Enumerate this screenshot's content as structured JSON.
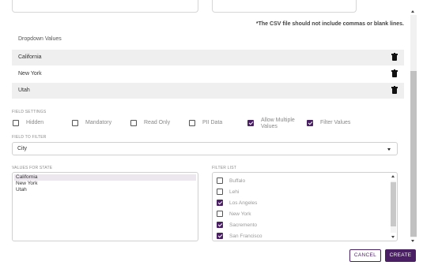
{
  "top_inputs": {
    "left_placeholder": "",
    "right_placeholder": ""
  },
  "csv_note": "*The CSV file should not include commas or blank lines.",
  "dropdown_values": {
    "label": "Dropdown Values",
    "items": [
      "California",
      "New York",
      "Utah"
    ]
  },
  "field_settings": {
    "label": "FIELD SETTINGS",
    "options": [
      {
        "label": "Hidden",
        "checked": false
      },
      {
        "label": "Mandatory",
        "checked": false
      },
      {
        "label": "Read Only",
        "checked": false
      },
      {
        "label": "PII Data",
        "checked": false
      },
      {
        "label": "Allow Multiple Values",
        "line1": "Allow Multiple",
        "line2": "Values",
        "checked": true
      },
      {
        "label": "Filter Values",
        "checked": true
      }
    ]
  },
  "field_to_filter": {
    "label": "FIELD TO FILTER",
    "value": "City"
  },
  "values_for_state": {
    "label": "VALUES FOR STATE",
    "options": [
      "California",
      "New York",
      "Utah"
    ],
    "selected": "California"
  },
  "filter_list": {
    "label": "FILTER LIST",
    "items": [
      {
        "label": "Buffalo",
        "checked": false
      },
      {
        "label": "Lehi",
        "checked": false
      },
      {
        "label": "Los Angeles",
        "checked": true
      },
      {
        "label": "New York",
        "checked": false
      },
      {
        "label": "Sacremento",
        "checked": true
      },
      {
        "label": "San Francisco",
        "checked": true
      }
    ]
  },
  "buttons": {
    "cancel": "CANCEL",
    "create": "CREATE"
  },
  "colors": {
    "accent": "#4a1f63",
    "row_shade": "#efefef"
  },
  "icons": {
    "delete": "trash-icon",
    "dropdown": "caret-down-icon"
  }
}
